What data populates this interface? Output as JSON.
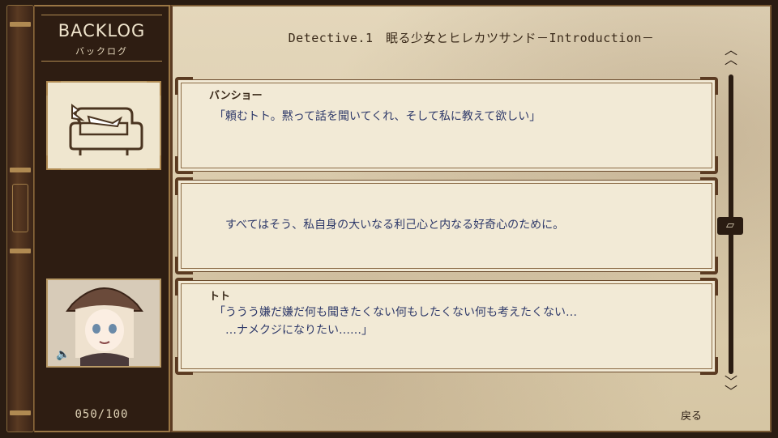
{
  "backlog": {
    "title": "BACKLOG",
    "subtitle": "バックログ",
    "counter": "050/100"
  },
  "chapter_title": "Detective.1　眠る少女とヒレカツサンド－Introduction－",
  "entries": [
    {
      "speaker": "バンショー",
      "text": "「頼むトト。黙って話を聞いてくれ、そして私に教えて欲しい」"
    },
    {
      "speaker": "",
      "text": "すべてはそう、私自身の大いなる利己心と内なる好奇心のために。"
    },
    {
      "speaker": "トト",
      "text": "「ううう嫌だ嫌だ何も聞きたくない何もしたくない何も考えたくない…\n　…ナメクジになりたい……」"
    }
  ],
  "scroll": {
    "up_icon": "double-chevron-up-icon",
    "down_icon": "double-chevron-down-icon",
    "thumb_icon": "book-icon"
  },
  "back_label": "戻る",
  "colors": {
    "parchment": "#e4d7bb",
    "dark_wood": "#2e1d12",
    "dialogue_text": "#2f3a6a",
    "gold_trim": "#b08a52"
  }
}
